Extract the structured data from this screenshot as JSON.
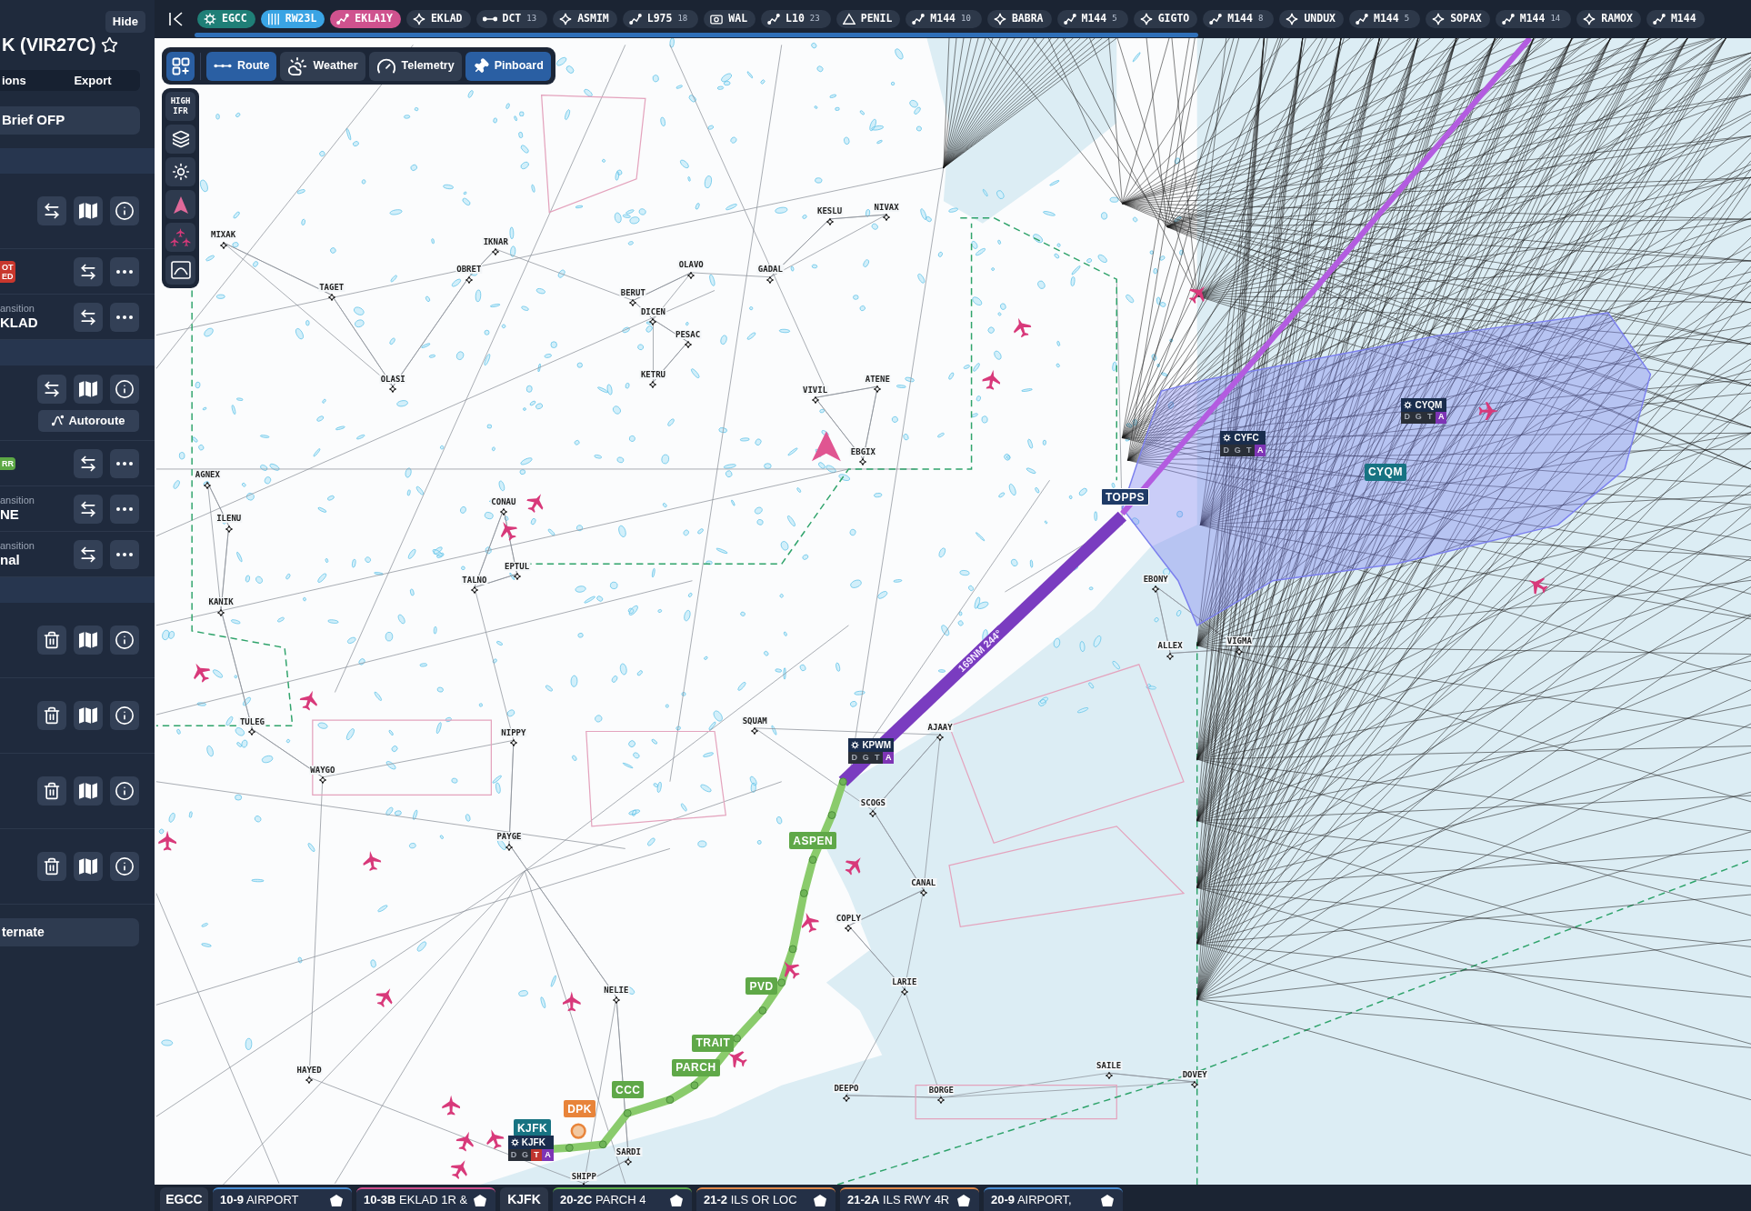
{
  "sidebar": {
    "hide_button": "Hide",
    "title": "K (VIR27C)",
    "starred": false,
    "actions": [
      "ions",
      "Export"
    ],
    "brief_button": "Brief OFP",
    "sections": [
      {
        "rows": [
          {
            "kind": "airport"
          },
          {
            "kind": "procedure",
            "badge": {
              "lines": [
                "OT",
                "ED"
              ],
              "color": "#c8372d"
            }
          },
          {
            "kind": "procedure",
            "caption": "ansition",
            "value": "KLAD"
          }
        ]
      },
      {
        "rows": [
          {
            "kind": "airport",
            "button": "Autoroute"
          },
          {
            "kind": "procedure",
            "badge": {
              "lines": [
                "RR"
              ],
              "color": "#5da845"
            }
          },
          {
            "kind": "procedure",
            "caption": "ansition",
            "value": "NE"
          },
          {
            "kind": "procedure",
            "caption": "ansition",
            "value": "nal"
          }
        ]
      },
      {
        "rows": [
          {
            "kind": "alternate"
          },
          {
            "kind": "alternate"
          },
          {
            "kind": "alternate"
          },
          {
            "kind": "alternate"
          }
        ]
      }
    ],
    "alternate_button": "ternate"
  },
  "route_bar": {
    "items": [
      {
        "kind": "airport",
        "label": "EGCC"
      },
      {
        "kind": "runway",
        "label": "RW23L"
      },
      {
        "kind": "procedure",
        "label": "EKLA1Y"
      },
      {
        "kind": "waypoint",
        "label": "EKLAD"
      },
      {
        "kind": "direct",
        "label": "DCT",
        "count": "13"
      },
      {
        "kind": "waypoint",
        "label": "ASMIM"
      },
      {
        "kind": "airway",
        "label": "L975",
        "count": "18"
      },
      {
        "kind": "vor",
        "label": "WAL"
      },
      {
        "kind": "airway",
        "label": "L10",
        "count": "23"
      },
      {
        "kind": "reporting",
        "label": "PENIL"
      },
      {
        "kind": "airway",
        "label": "M144",
        "count": "10"
      },
      {
        "kind": "waypoint",
        "label": "BABRA"
      },
      {
        "kind": "airway",
        "label": "M144",
        "count": "5"
      },
      {
        "kind": "waypoint",
        "label": "GIGTO"
      },
      {
        "kind": "airway",
        "label": "M144",
        "count": "8"
      },
      {
        "kind": "waypoint",
        "label": "UNDUX"
      },
      {
        "kind": "airway",
        "label": "M144",
        "count": "5"
      },
      {
        "kind": "waypoint",
        "label": "SOPAX"
      },
      {
        "kind": "airway",
        "label": "M144",
        "count": "14"
      },
      {
        "kind": "waypoint",
        "label": "RAMOX"
      },
      {
        "kind": "airway",
        "label": "M144"
      }
    ]
  },
  "map_toolbar": {
    "buttons": [
      {
        "label": "Route",
        "on": true
      },
      {
        "label": "Weather",
        "on": false
      },
      {
        "label": "Telemetry",
        "on": false
      },
      {
        "label": "Pinboard",
        "on": true
      }
    ]
  },
  "map_tools": {
    "chart_type": "HIGH IFR"
  },
  "map": {
    "route_distance": "169NM 244°",
    "fixes": [
      {
        "label": "KJFK",
        "kind": "airport"
      },
      {
        "label": "DPK",
        "kind": "navaid"
      },
      {
        "label": "CCC",
        "kind": "route"
      },
      {
        "label": "PARCH",
        "kind": "route"
      },
      {
        "label": "TRAIT",
        "kind": "route"
      },
      {
        "label": "PVD",
        "kind": "route"
      },
      {
        "label": "ASPEN",
        "kind": "route"
      },
      {
        "label": "TOPPS",
        "kind": "waypoint"
      },
      {
        "label": "CYQM",
        "kind": "airport"
      }
    ],
    "airports": [
      {
        "code": "KJFK",
        "letters": [
          {
            "text": "D",
            "active": false
          },
          {
            "text": "G",
            "active": false
          },
          {
            "text": "T",
            "active": true,
            "color": "#c0352f"
          },
          {
            "text": "A",
            "active": true,
            "color": "#7e35b5"
          }
        ]
      },
      {
        "code": "KPWM",
        "letters": [
          {
            "text": "D",
            "active": false
          },
          {
            "text": "G",
            "active": false
          },
          {
            "text": "T",
            "active": false
          },
          {
            "text": "A",
            "active": true,
            "color": "#7e35b5"
          }
        ]
      },
      {
        "code": "CYFC",
        "letters": [
          {
            "text": "D",
            "active": false
          },
          {
            "text": "G",
            "active": false
          },
          {
            "text": "T",
            "active": false
          },
          {
            "text": "A",
            "active": true,
            "color": "#7e35b5"
          }
        ]
      },
      {
        "code": "CYQM",
        "letters": [
          {
            "text": "D",
            "active": false
          },
          {
            "text": "G",
            "active": false
          },
          {
            "text": "T",
            "active": false
          },
          {
            "text": "A",
            "active": true,
            "color": "#7e35b5"
          }
        ]
      }
    ],
    "waypoints": [
      "MIXAK",
      "IKNAR",
      "OBRET",
      "TAGET",
      "OLAVO",
      "GADAL",
      "KESLU",
      "NIVAX",
      "BERUT",
      "DICEN",
      "PESAC",
      "OLASI",
      "KETRU",
      "VIVIL",
      "ATENE",
      "EBGIX",
      "CONAU",
      "EPTUL",
      "TALNO",
      "SQUAM",
      "AJAAY",
      "SCOGS",
      "CANAL",
      "COPLY",
      "LARIE",
      "ALLEX",
      "VIGMA",
      "EBONY",
      "SAILE",
      "DOVEY",
      "BORGE",
      "DEEPO",
      "SHIPP",
      "SARDI",
      "NELIE",
      "HAYED",
      "PAYGE",
      "WAYGO",
      "NIPPY",
      "TULEG",
      "AGNEX",
      "ILENU",
      "KANIK"
    ]
  },
  "chart_tabs": [
    {
      "kind": "airport",
      "label": "EGCC"
    },
    {
      "kind": "chart",
      "code": "10-9",
      "title": "AIRPORT",
      "color": "#4a8fd6"
    },
    {
      "kind": "chart",
      "code": "10-3B",
      "title": "EKLAD 1R &",
      "color": "#d0508e"
    },
    {
      "kind": "airport",
      "label": "KJFK"
    },
    {
      "kind": "chart",
      "code": "20-2C",
      "title": "PARCH 4",
      "color": "#5fae4c"
    },
    {
      "kind": "chart",
      "code": "21-2",
      "title": "ILS OR LOC",
      "color": "#e0894a"
    },
    {
      "kind": "chart",
      "code": "21-2A",
      "title": "ILS RWY 4R",
      "color": "#e0894a"
    },
    {
      "kind": "chart",
      "code": "20-9",
      "title": "AIRPORT,",
      "color": "#4a8fd6"
    }
  ]
}
